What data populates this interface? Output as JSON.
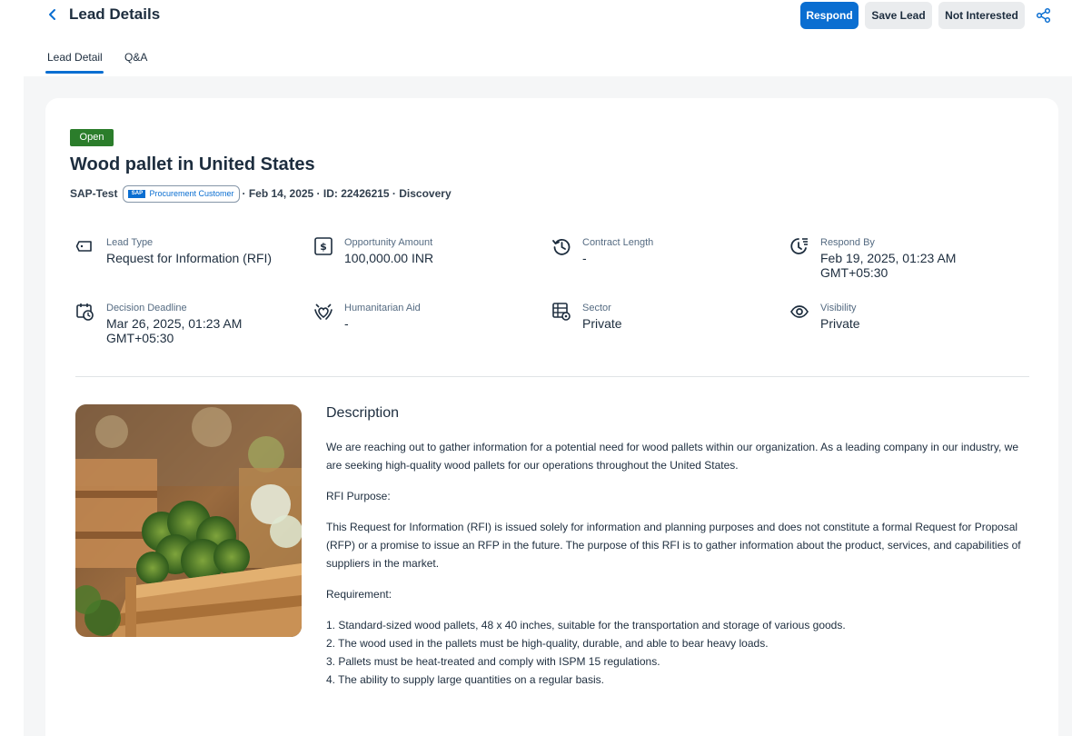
{
  "header": {
    "title": "Lead Details",
    "respond_label": "Respond",
    "save_label": "Save Lead",
    "not_interested_label": "Not Interested"
  },
  "tabs": [
    {
      "label": "Lead Detail",
      "selected": true
    },
    {
      "label": "Q&A",
      "selected": false
    }
  ],
  "lead": {
    "status": "Open",
    "title": "Wood pallet in United States",
    "buyer": "SAP-Test",
    "customer_logo_text": "SAP",
    "customer_badge": "Procurement Customer",
    "meta_rest": "· Feb 14, 2025 · ID: 22426215 · Discovery"
  },
  "fields": [
    {
      "icon": "tag-icon",
      "label": "Lead Type",
      "value": "Request for Information (RFI)"
    },
    {
      "icon": "money-icon",
      "label": "Opportunity Amount",
      "value": "100,000.00 INR"
    },
    {
      "icon": "history-icon",
      "label": "Contract Length",
      "value": "-"
    },
    {
      "icon": "respond-by-icon",
      "label": "Respond By",
      "value": "Feb 19, 2025, 01:23 AM GMT+05:30"
    },
    {
      "icon": "calendar-deadline-icon",
      "label": "Decision Deadline",
      "value": "Mar 26, 2025, 01:23 AM GMT+05:30"
    },
    {
      "icon": "humanitarian-icon",
      "label": "Humanitarian Aid",
      "value": "-"
    },
    {
      "icon": "sector-icon",
      "label": "Sector",
      "value": "Private"
    },
    {
      "icon": "eye-icon",
      "label": "Visibility",
      "value": "Private"
    }
  ],
  "description": {
    "heading": "Description",
    "intro": "We are reaching out to gather information for a potential need for wood pallets within our organization. As a leading company in our industry, we are seeking high-quality wood pallets for our operations throughout the United States.",
    "purpose_heading": "RFI Purpose:",
    "purpose": "This Request for Information (RFI) is issued solely for information and planning purposes and does not constitute a formal Request for Proposal (RFP) or a promise to issue an RFP in the future. The purpose of this RFI is to gather information about the product, services, and capabilities of suppliers in the market.",
    "requirement_heading": "Requirement:",
    "requirements": [
      "1. Standard-sized wood pallets, 48 x 40 inches, suitable for the transportation and storage of various goods.",
      "2. The wood used in the pallets must be high-quality, durable, and able to bear heavy loads.",
      "3. Pallets must be heat-treated and comply with ISPM 15 regulations.",
      "4. The ability to supply large quantities on a regular basis."
    ]
  },
  "colors": {
    "accent": "#0a6ed1",
    "status_open": "#2b7d2b",
    "background": "#f5f6f7"
  }
}
